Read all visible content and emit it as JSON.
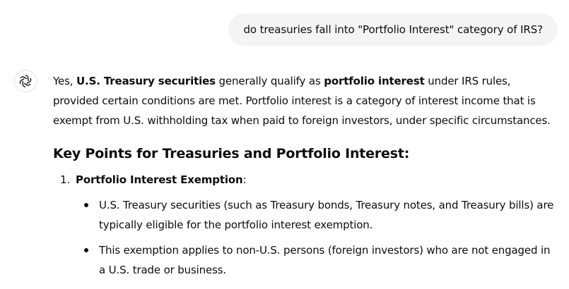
{
  "user_message": "do treasuries fall into \"Portfolio Interest\" category of IRS?",
  "assistant": {
    "avatar_icon": "openai-logo-icon",
    "intro": {
      "t1": "Yes, ",
      "b1": "U.S. Treasury securities",
      "t2": " generally qualify as ",
      "b2": "portfolio interest",
      "t3": " under IRS rules, provided certain conditions are met. Portfolio interest is a category of interest income that is exempt from U.S. withholding tax when paid to foreign investors, under specific circumstances."
    },
    "heading": "Key Points for Treasuries and Portfolio Interest:",
    "items": [
      {
        "number": "1.",
        "title": "Portfolio Interest Exemption",
        "suffix": ":",
        "bullets": [
          "U.S. Treasury securities (such as Treasury bonds, Treasury notes, and Treasury bills) are typically eligible for the portfolio interest exemption.",
          "This exemption applies to non-U.S. persons (foreign investors) who are not engaged in a U.S. trade or business."
        ]
      }
    ]
  }
}
